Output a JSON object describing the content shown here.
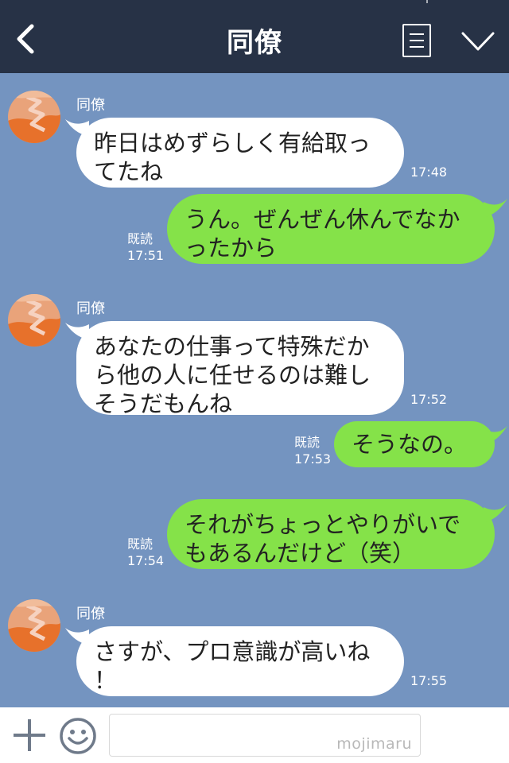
{
  "header": {
    "title": "同僚",
    "back_icon": "chevron-left-icon",
    "menu_icon": "note-icon",
    "expand_icon": "chevron-down-icon"
  },
  "messages": [
    {
      "side": "in",
      "sender": "同僚",
      "text": "昨日はめずらしく有給取っ\nてたね",
      "time": "17:48"
    },
    {
      "side": "out",
      "read": "既読",
      "text": "うん。ぜんぜん休んでなか\nったから",
      "time": "17:51"
    },
    {
      "side": "in",
      "sender": "同僚",
      "text": "あなたの仕事って特殊だか\nら他の人に任せるのは難し\nそうだもんね",
      "time": "17:52"
    },
    {
      "side": "out",
      "read": "既読",
      "text": "そうなの。",
      "time": "17:53"
    },
    {
      "side": "out",
      "read": "既読",
      "text": "それがちょっとやりがいで\nもあるんだけど（笑）",
      "time": "17:54"
    },
    {
      "side": "in",
      "sender": "同僚",
      "text": "さすが、プロ意識が高いね\n！",
      "time": "17:55"
    }
  ],
  "footer": {
    "input_value": "",
    "watermark": "mojimaru",
    "plus_icon": "plus-icon",
    "emoji_icon": "smile-icon",
    "call_icon": "phone-icon"
  },
  "colors": {
    "header_bg": "#273246",
    "chat_bg": "#7494c0",
    "incoming_bubble": "#ffffff",
    "outgoing_bubble": "#85e249",
    "call_button": "#4a82e0"
  }
}
